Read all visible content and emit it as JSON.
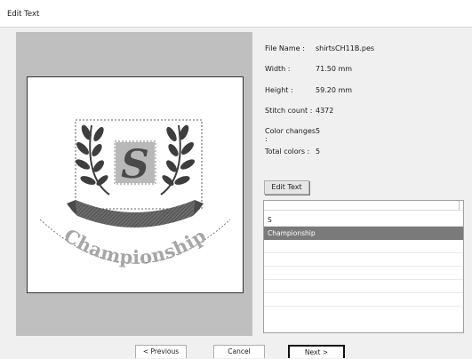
{
  "window": {
    "title": "Edit Text"
  },
  "design_text": {
    "monogram": "S",
    "banner": "Championship"
  },
  "info": [
    {
      "label": "File Name :",
      "value": "shirtsCH11B.pes"
    },
    {
      "label": "Width :",
      "value": "71.50   mm"
    },
    {
      "label": "Height :",
      "value": "59.20   mm"
    },
    {
      "label": "Stitch count :",
      "value": "4372"
    },
    {
      "label": "Color changes :",
      "value": "5"
    },
    {
      "label": "Total colors :",
      "value": "5"
    }
  ],
  "edit_text_button": "Edit Text",
  "text_list": {
    "items": [
      "S",
      "Championship"
    ],
    "selected": "Championship"
  },
  "buttons": {
    "previous": "< Previous",
    "cancel": "Cancel",
    "next": "Next >"
  }
}
